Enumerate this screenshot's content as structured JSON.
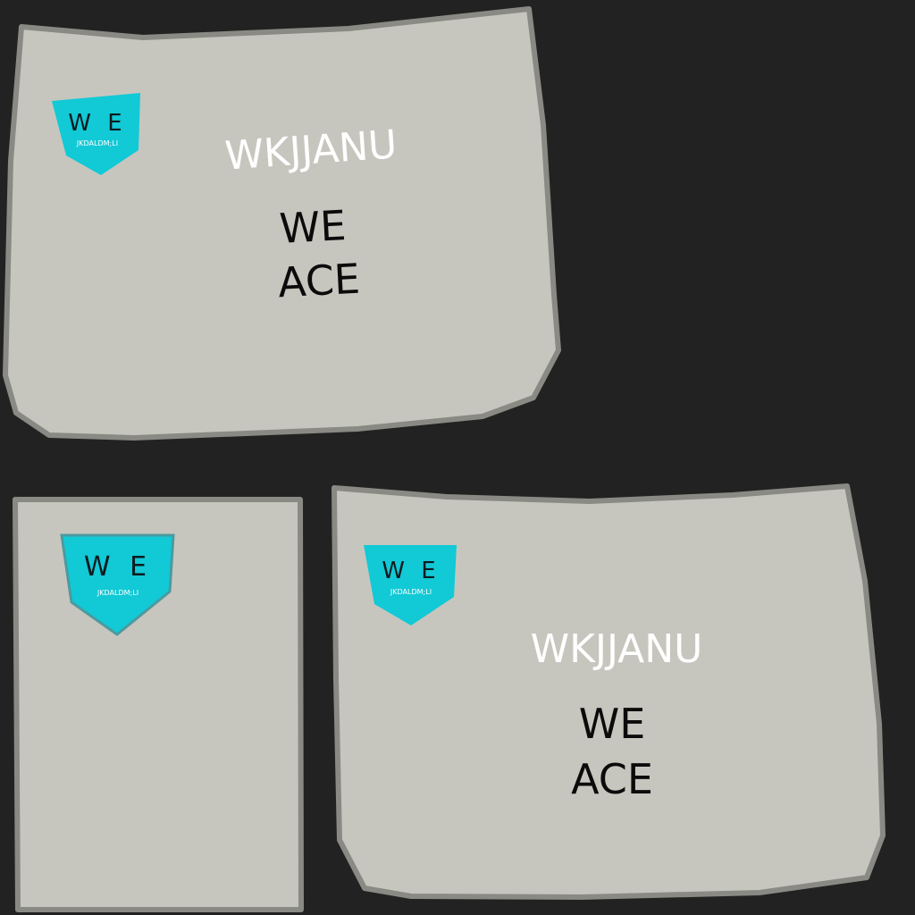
{
  "colors": {
    "background": "#222222",
    "panel_fill": "#c7c6be",
    "panel_border": "#8a8a84",
    "badge": "#12c9d6",
    "title_text": "#ffffff",
    "body_text": "#0b0b0b"
  },
  "panel_top": {
    "badge_initials": "W E",
    "badge_sub": "JKDALDM;LI",
    "title": "WKJJANU",
    "line_1": "WE",
    "line_2": "ACE"
  },
  "panel_small": {
    "badge_initials": "W E",
    "badge_sub": "JKDALDM;LI"
  },
  "panel_bottom": {
    "badge_initials": "W E",
    "badge_sub": "JKDALDM;LI",
    "title": "WKJJANU",
    "line_1": "WE",
    "line_2": "ACE"
  }
}
